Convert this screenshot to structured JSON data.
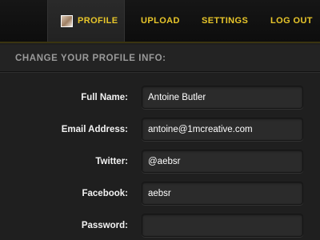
{
  "nav": {
    "items": [
      {
        "label": "PROFILE"
      },
      {
        "label": "UPLOAD"
      },
      {
        "label": "SETTINGS"
      },
      {
        "label": "LOG OUT"
      }
    ],
    "accent_color": "#e8c62a"
  },
  "section": {
    "title": "CHANGE YOUR PROFILE INFO:"
  },
  "form": {
    "full_name": {
      "label": "Full Name:",
      "value": "Antoine Butler"
    },
    "email": {
      "label": "Email Address:",
      "value": "antoine@1mcreative.com"
    },
    "twitter": {
      "label": "Twitter:",
      "value": "@aebsr"
    },
    "facebook": {
      "label": "Facebook:",
      "value": "aebsr"
    },
    "password": {
      "label": "Password:",
      "value": ""
    }
  }
}
